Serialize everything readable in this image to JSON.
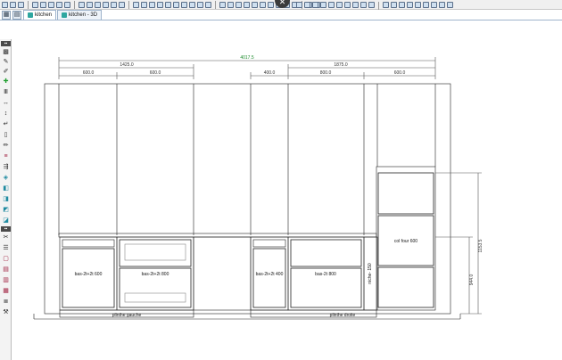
{
  "toolbar": {
    "close_glyph": "✕",
    "icon_names": [
      "select-icon",
      "undo-icon",
      "redo-icon",
      "zoom-in-icon",
      "zoom-out-icon",
      "pan-icon",
      "measure-icon",
      "layers-icon",
      "render-icon",
      "settings-icon"
    ]
  },
  "tabs": [
    {
      "label": "kitchen",
      "active": true
    },
    {
      "label": "kitchen - 3D",
      "active": false
    }
  ],
  "drawing": {
    "total_width": "4017.5",
    "left_group": "1425.0",
    "right_group": "1875.0",
    "left_sub_1": "600.0",
    "left_sub_2": "600.0",
    "right_sub_1": "400.0",
    "right_sub_2": "800.0",
    "right_sub_3": "600.0",
    "height_overall": "1153.5",
    "height_lower": "944.0",
    "cabinets": {
      "c1": "bas-2t+2t 600",
      "c2": "bas-2t+2t 800",
      "c3": "bas-2t+2t 400",
      "c4": "bas-2t 800",
      "c5": "niche- 150",
      "c6": "col four 600"
    },
    "plinth_left": "plinthe gauche",
    "plinth_right": "plinthe droite"
  }
}
